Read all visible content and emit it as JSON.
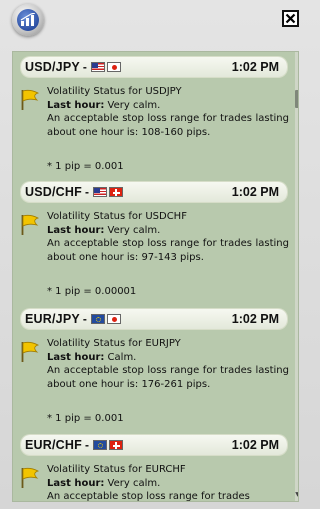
{
  "window": {
    "logo_icon": "chart-bars-icon",
    "close_icon": "close-x-icon"
  },
  "entries": [
    {
      "pair": "USD/JPY",
      "separator": "-",
      "flags": [
        "us",
        "jp"
      ],
      "time": "1:02 PM",
      "title": "Volatility Status for USDJPY",
      "last_hour_label": "Last hour:",
      "last_hour_value": " Very calm.",
      "range_text": "An acceptable stop loss range for trades lasting about one hour is: 108-160 pips.",
      "pip_note": "* 1 pip = 0.001"
    },
    {
      "pair": "USD/CHF",
      "separator": "-",
      "flags": [
        "us",
        "ch"
      ],
      "time": "1:02 PM",
      "title": "Volatility Status for USDCHF",
      "last_hour_label": "Last hour:",
      "last_hour_value": " Very calm.",
      "range_text": "An acceptable stop loss range for trades lasting about one hour is: 97-143 pips.",
      "pip_note": "* 1 pip = 0.00001"
    },
    {
      "pair": "EUR/JPY",
      "separator": "-",
      "flags": [
        "eu",
        "jp"
      ],
      "time": "1:02 PM",
      "title": "Volatility Status for EURJPY",
      "last_hour_label": "Last hour:",
      "last_hour_value": " Calm.",
      "range_text": "An acceptable stop loss range for trades lasting about one hour is: 176-261 pips.",
      "pip_note": "* 1 pip = 0.001"
    },
    {
      "pair": "EUR/CHF",
      "separator": "-",
      "flags": [
        "eu",
        "ch"
      ],
      "time": "1:02 PM",
      "title": "Volatility Status for EURCHF",
      "last_hour_label": "Last hour:",
      "last_hour_value": " Very calm.",
      "range_text": "An acceptable stop loss range for trades",
      "pip_note": ""
    }
  ],
  "colors": {
    "panel_bg": "#b8c9ad",
    "header_bg": "#eef1e7",
    "flag_icon_yellow": "#f2c400"
  }
}
